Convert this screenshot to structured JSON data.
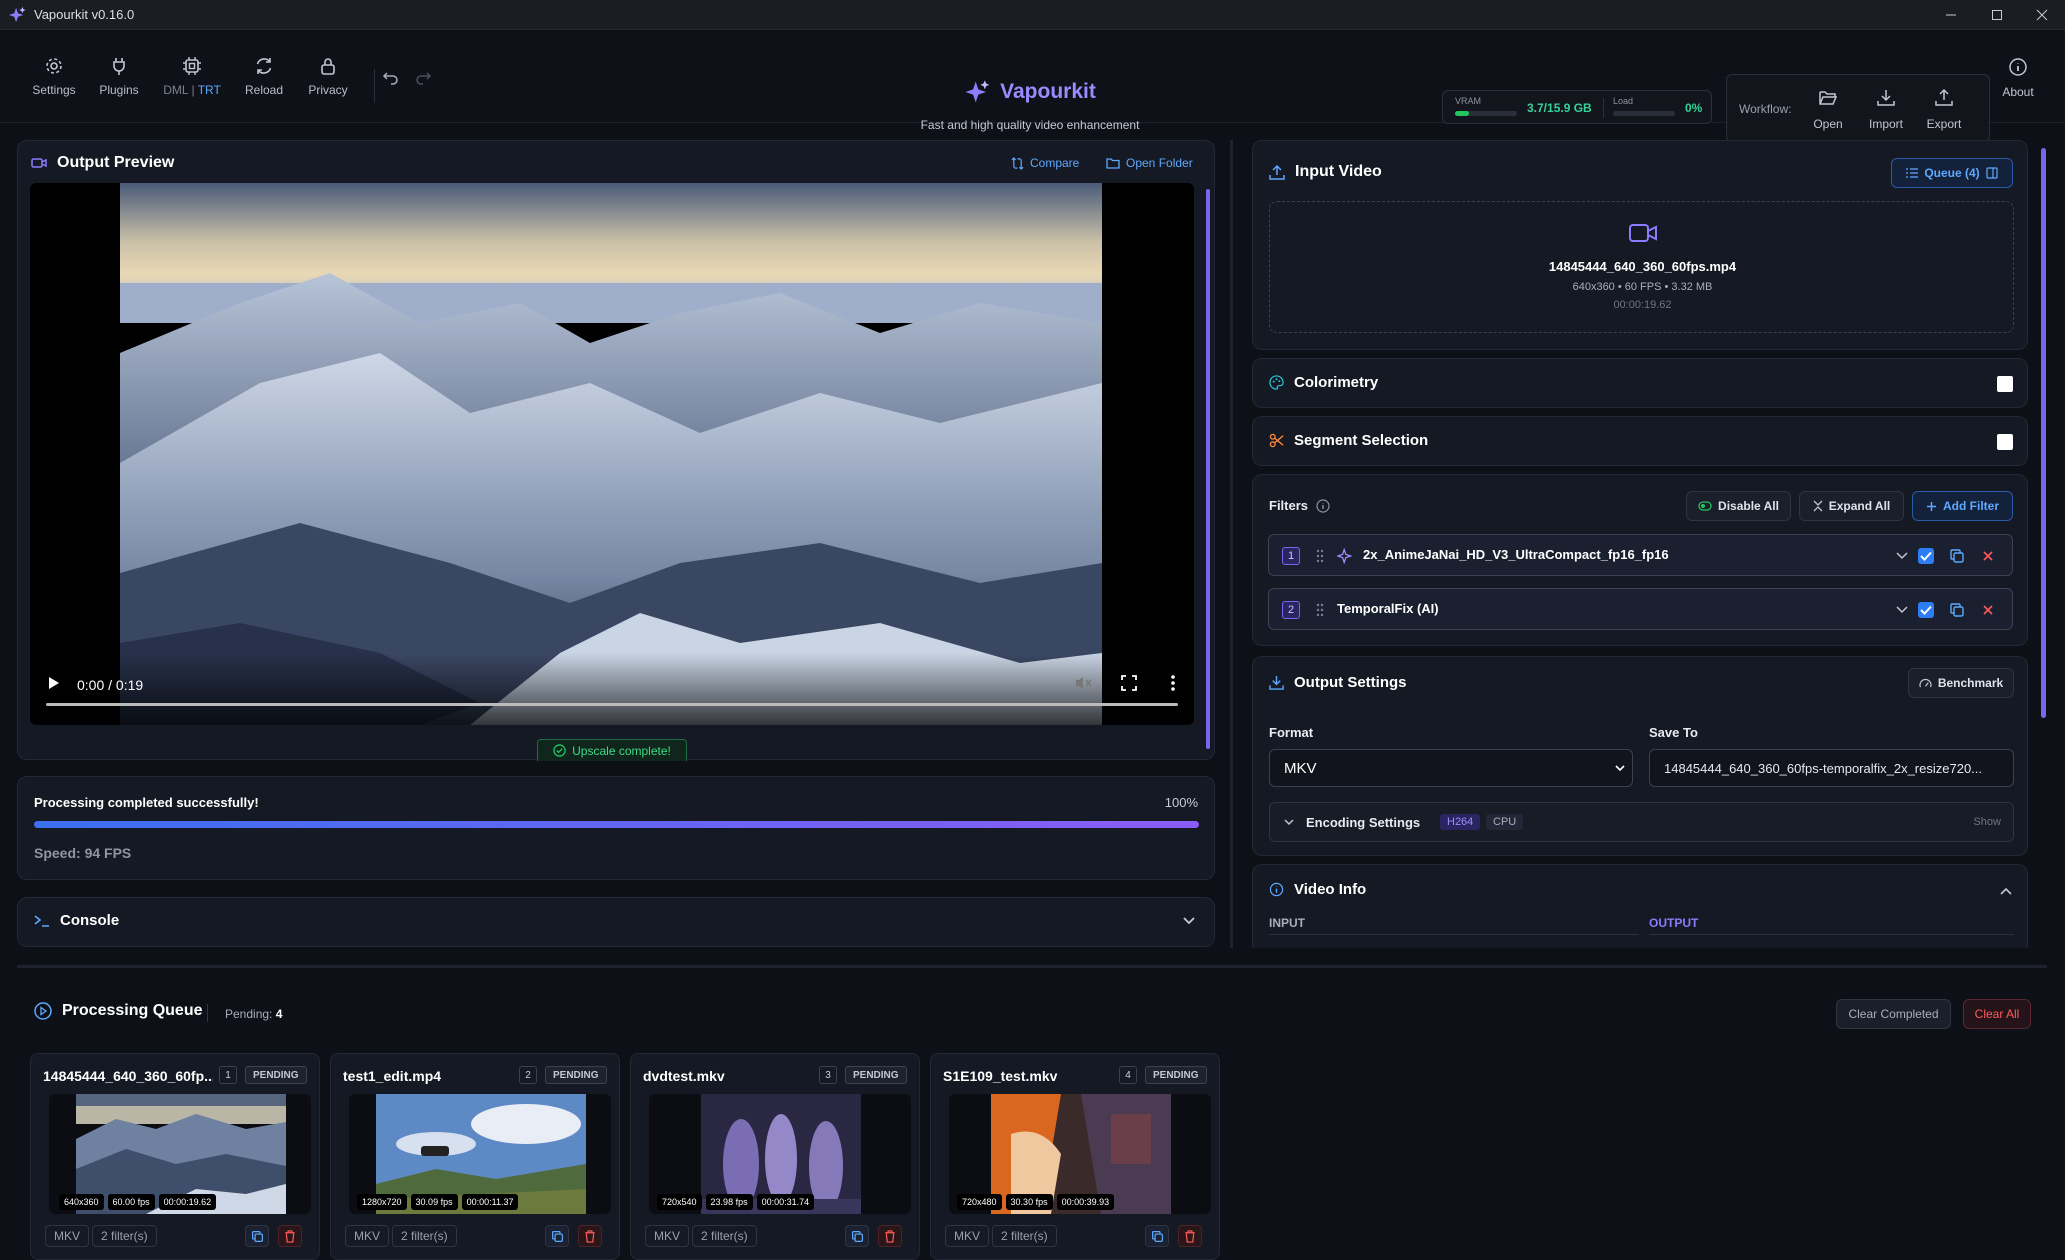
{
  "window": {
    "title": "Vapourkit v0.16.0"
  },
  "toolbar": {
    "settings": "Settings",
    "plugins": "Plugins",
    "backend_dml": "DML",
    "backend_sep": "|",
    "backend_trt": "TRT",
    "reload": "Reload",
    "privacy": "Privacy"
  },
  "brand": {
    "name": "Vapourkit",
    "tagline": "Fast and high quality video enhancement"
  },
  "stats": {
    "vram_label": "VRAM",
    "vram_value": "3.7/15.9 GB",
    "vram_fraction": 0.23,
    "load_label": "Load",
    "load_value": "0%",
    "load_fraction": 0.0
  },
  "workflow": {
    "label": "Workflow:",
    "open": "Open",
    "import": "Import",
    "export": "Export",
    "about": "About"
  },
  "preview": {
    "title": "Output Preview",
    "compare": "Compare",
    "open_folder": "Open Folder",
    "player_time": "0:00 / 0:19",
    "complete_toast": "Upscale complete!"
  },
  "progress": {
    "message": "Processing completed successfully!",
    "percent_label": "100%",
    "fraction": 1.0,
    "speed": "Speed: 94 FPS"
  },
  "console": {
    "title": "Console"
  },
  "input_video": {
    "title": "Input Video",
    "queue_label": "Queue (4)",
    "filename": "14845444_640_360_60fps.mp4",
    "meta": "640x360 • 60 FPS • 3.32 MB",
    "duration": "00:00:19.62"
  },
  "colorimetry": {
    "title": "Colorimetry"
  },
  "segment": {
    "title": "Segment Selection"
  },
  "filters": {
    "title": "Filters",
    "disable_all": "Disable All",
    "expand_all": "Expand All",
    "add_filter": "Add Filter",
    "items": [
      {
        "index": "1",
        "name": "2x_AnimeJaNai_HD_V3_UltraCompact_fp16_fp16"
      },
      {
        "index": "2",
        "name": "TemporalFix (AI)"
      }
    ]
  },
  "output_settings": {
    "title": "Output Settings",
    "benchmark": "Benchmark",
    "format_label": "Format",
    "format_value": "MKV",
    "save_to_label": "Save To",
    "save_to_value": "14845444_640_360_60fps-temporalfix_2x_resize720...",
    "encoding_label": "Encoding Settings",
    "codec": "H264",
    "device": "CPU",
    "show": "Show"
  },
  "video_info": {
    "title": "Video Info",
    "input": "INPUT",
    "output": "OUTPUT"
  },
  "queue": {
    "title": "Processing Queue",
    "pending_label": "Pending:",
    "pending_count": "4",
    "clear_completed": "Clear Completed",
    "clear_all": "Clear All",
    "items": [
      {
        "name": "14845444_640_360_60fp...",
        "index": "1",
        "status": "PENDING",
        "res": "640x360",
        "fps": "60.00 fps",
        "dur": "00:00:19.62",
        "format": "MKV",
        "filters": "2 filter(s)"
      },
      {
        "name": "test1_edit.mp4",
        "index": "2",
        "status": "PENDING",
        "res": "1280x720",
        "fps": "30.09 fps",
        "dur": "00:00:11.37",
        "format": "MKV",
        "filters": "2 filter(s)"
      },
      {
        "name": "dvdtest.mkv",
        "index": "3",
        "status": "PENDING",
        "res": "720x540",
        "fps": "23.98 fps",
        "dur": "00:00:31.74",
        "format": "MKV",
        "filters": "2 filter(s)"
      },
      {
        "name": "S1E109_test.mkv",
        "index": "4",
        "status": "PENDING",
        "res": "720x480",
        "fps": "30.30 fps",
        "dur": "00:00:39.93",
        "format": "MKV",
        "filters": "2 filter(s)"
      }
    ]
  },
  "colors": {
    "accent": "#8b7bff",
    "link": "#5da9ff",
    "danger": "#ff5a5a",
    "success": "#22c55e"
  }
}
